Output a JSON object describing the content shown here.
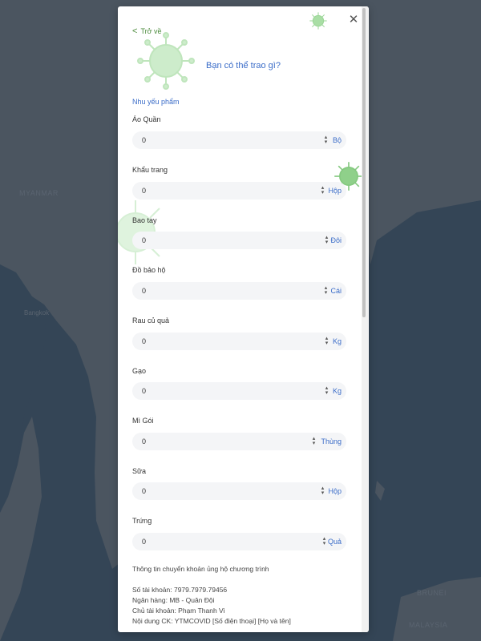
{
  "map": {
    "labels": [
      "MYANMAR",
      "Bangkok",
      "BRUNEI",
      "MALAYSIA"
    ]
  },
  "modal": {
    "back_label": "Trở về",
    "title": "Bạn có thể trao gì?",
    "section_label": "Nhu yếu phẩm",
    "close_icon": "close-icon",
    "fields": [
      {
        "label": "Áo Quần",
        "value": "0",
        "unit": "Bộ"
      },
      {
        "label": "Khẩu trang",
        "value": "0",
        "unit": "Hộp"
      },
      {
        "label": "Bao tay",
        "value": "0",
        "unit": "Đôi"
      },
      {
        "label": "Đồ bảo hộ",
        "value": "0",
        "unit": "Cái"
      },
      {
        "label": "Rau củ quả",
        "value": "0",
        "unit": "Kg"
      },
      {
        "label": "Gạo",
        "value": "0",
        "unit": "Kg"
      },
      {
        "label": "Mì Gói",
        "value": "0",
        "unit": "Thùng"
      },
      {
        "label": "Sữa",
        "value": "0",
        "unit": "Hộp"
      },
      {
        "label": "Trứng",
        "value": "0",
        "unit": "Quả"
      }
    ],
    "transfer_heading": "Thông tin chuyển khoản ủng hộ chương trình",
    "account_number": "Số tài khoản: 7979.7979.79456",
    "bank": "Ngân hàng: MB - Quân Đội",
    "account_holder": "Chủ tài khoản: Phạm Thanh Vi",
    "transfer_content": "Nội dung CK: YTMCOVID [Số điện thoại] [Họ và tên]"
  },
  "colors": {
    "accent": "#3a6cc8",
    "back": "#4a8a3a",
    "virus": "#9ed89a"
  }
}
